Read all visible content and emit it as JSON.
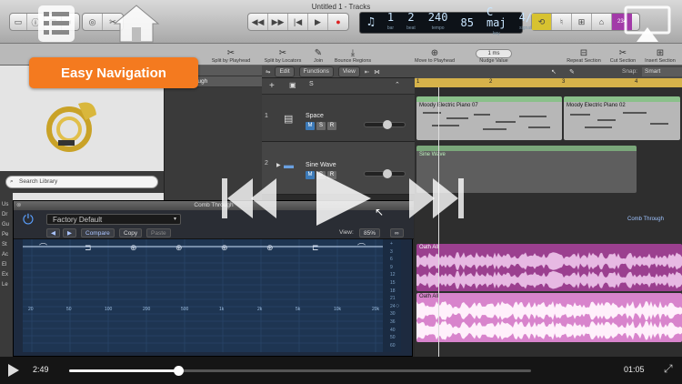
{
  "window": {
    "title": "Untitled 1 - Tracks"
  },
  "lcd": {
    "bar": "1",
    "bar_label": "bar",
    "beat": "2",
    "beat_label": "beat",
    "div": "1",
    "div_label": "div",
    "tick": "1",
    "tick_label": "tick",
    "tempo": "240",
    "tempo_label": "tempo",
    "tempo2": "85",
    "key": "C maj",
    "key_label": "key",
    "signature": "4/4",
    "signature_label": "signature",
    "counter": "234"
  },
  "toolbar": {
    "split_playhead": "Split by Playhead",
    "split_locators": "Split by Locators",
    "join": "Join",
    "bounce": "Bounce Regions",
    "move_playhead": "Move to Playhead",
    "nudge_value": "Nudge Value",
    "nudge_amount": "1 ms",
    "repeat": "Repeat Section",
    "cut": "Cut Section",
    "insert": "Insert Section"
  },
  "banner": {
    "label": "Easy Navigation"
  },
  "library": {
    "search_placeholder": "Search Library",
    "side_letters": [
      "Us",
      "Dr",
      "Gu",
      "Pe",
      "St",
      "Ac",
      "El",
      "Ex",
      "Le"
    ]
  },
  "strips": {
    "labels": [
      "Oath All",
      "Comb Through"
    ]
  },
  "tracks_bar": {
    "edit": "Edit",
    "functions": "Functions",
    "view": "View",
    "snap_label": "Snap:",
    "snap_value": "Smart"
  },
  "ruler": {
    "marks": [
      "1",
      "2",
      "3",
      "4"
    ]
  },
  "tracks": [
    {
      "num": "1",
      "name": "Space"
    },
    {
      "num": "2",
      "name": "Sine Wave"
    }
  ],
  "regions": {
    "midi1": "Moody Electric Piano 07",
    "midi2": "Moody Electric Piano 02",
    "sine": "Sine Wave",
    "comb_label": "Comb Through",
    "audio1": "Oath All",
    "audio2": "Oath All"
  },
  "plugin": {
    "title": "Comb Through",
    "preset": "Factory Default",
    "compare": "Compare",
    "copy": "Copy",
    "paste": "Paste",
    "view_label": "View:",
    "view_value": "85%",
    "freq_labels": [
      "20",
      "50",
      "100",
      "200",
      "500",
      "1k",
      "2k",
      "5k",
      "10k",
      "20k"
    ],
    "db_labels": [
      "+",
      "3",
      "6",
      "9",
      "12",
      "15",
      "18",
      "21",
      "24",
      "30",
      "36",
      "40",
      "50",
      "60"
    ]
  },
  "playbar": {
    "elapsed": "2:49",
    "remaining": "01:05",
    "progress": 0.236
  },
  "colors": {
    "banner": "#f47a1f",
    "ruler": "#d6b24a",
    "audio": "#9b3f8f",
    "midi_header": "#8ac08a"
  }
}
